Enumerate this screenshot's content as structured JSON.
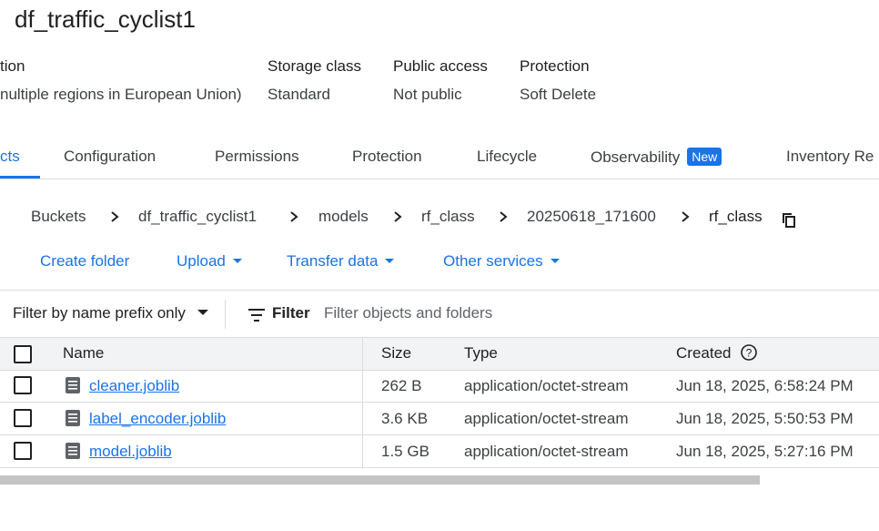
{
  "bucket_title": "df_traffic_cyclist1",
  "info": {
    "location_label": "tion",
    "location_value": "nultiple regions in European Union)",
    "storage_label": "Storage class",
    "storage_value": "Standard",
    "public_label": "Public access",
    "public_value": "Not public",
    "protection_label": "Protection",
    "protection_value": "Soft Delete"
  },
  "tabs": [
    {
      "label": "cts"
    },
    {
      "label": "Configuration"
    },
    {
      "label": "Permissions"
    },
    {
      "label": "Protection"
    },
    {
      "label": "Lifecycle"
    },
    {
      "label": "Observability",
      "badge": "New"
    },
    {
      "label": "Inventory Re"
    }
  ],
  "breadcrumb": [
    "Buckets",
    "df_traffic_cyclist1",
    "models",
    "rf_class",
    "20250618_171600",
    "rf_class"
  ],
  "actions": {
    "create_folder": "Create folder",
    "upload": "Upload",
    "transfer": "Transfer data",
    "other": "Other services"
  },
  "filter": {
    "mode": "Filter by name prefix only",
    "label": "Filter",
    "placeholder": "Filter objects and folders"
  },
  "table": {
    "headers": {
      "name": "Name",
      "size": "Size",
      "type": "Type",
      "created": "Created"
    },
    "rows": [
      {
        "name": "cleaner.joblib",
        "size": "262 B",
        "type": "application/octet-stream",
        "created": "Jun 18, 2025, 6:58:24 PM"
      },
      {
        "name": "label_encoder.joblib",
        "size": "3.6 KB",
        "type": "application/octet-stream",
        "created": "Jun 18, 2025, 5:50:53 PM"
      },
      {
        "name": "model.joblib",
        "size": "1.5 GB",
        "type": "application/octet-stream",
        "created": "Jun 18, 2025, 5:27:16 PM"
      }
    ]
  },
  "colors": {
    "accent": "#1a73e8",
    "text": "#202124",
    "muted": "#3c4043",
    "border": "#dadce0"
  }
}
